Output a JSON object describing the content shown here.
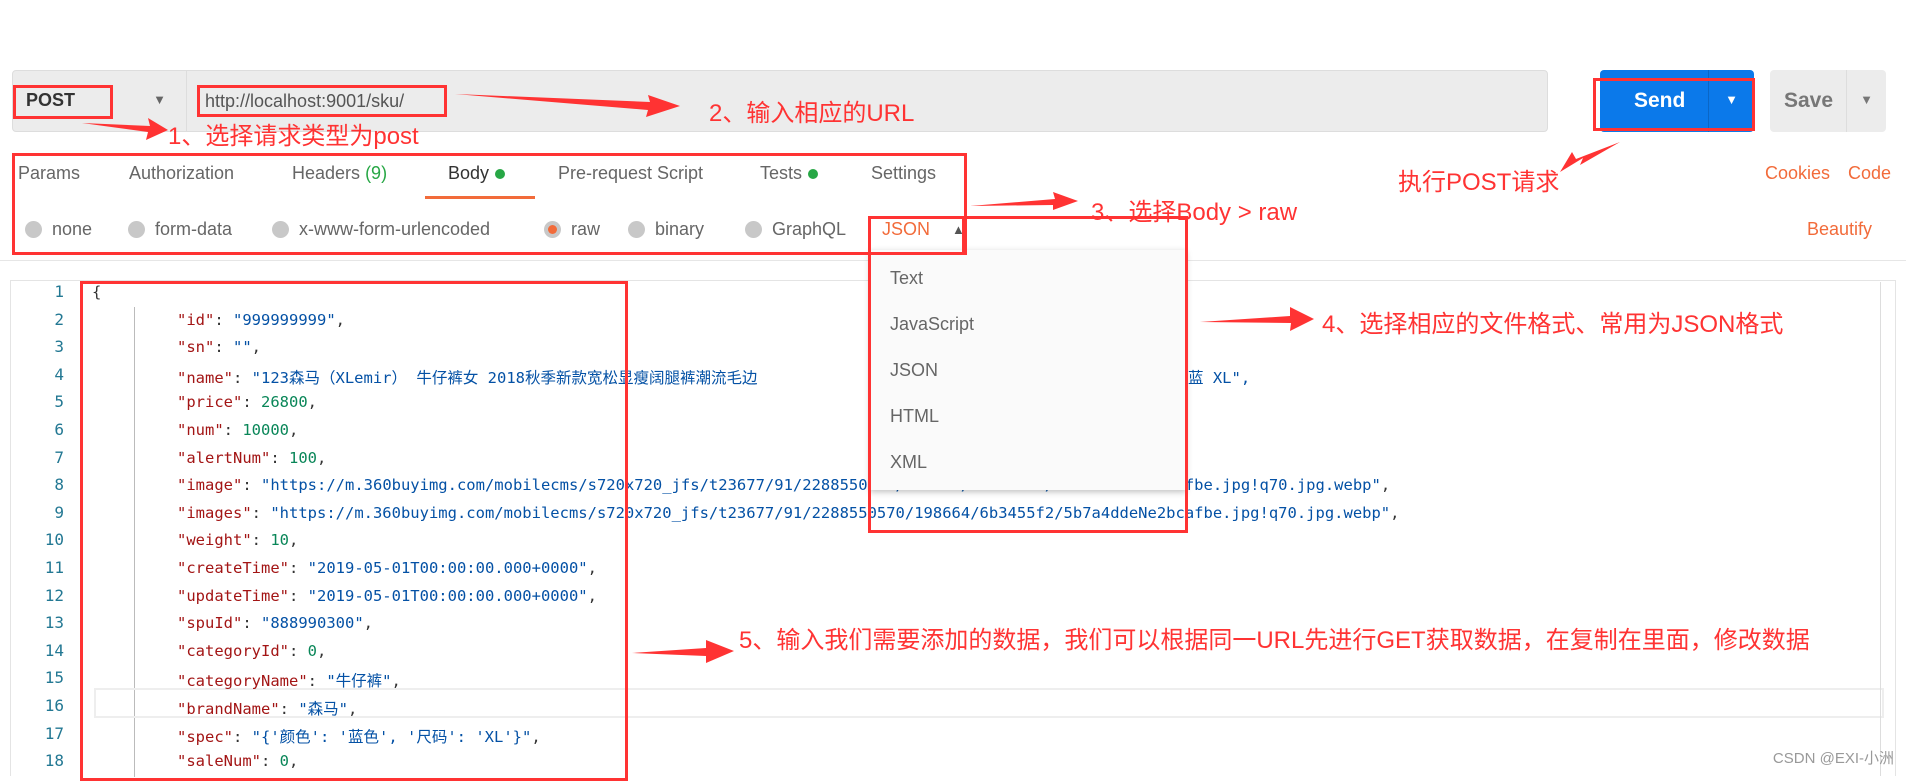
{
  "request": {
    "method": "POST",
    "url": "http://localhost:9001/sku/",
    "send_label": "Send",
    "save_label": "Save"
  },
  "tabs": [
    {
      "label": "Params"
    },
    {
      "label": "Authorization"
    },
    {
      "label": "Headers",
      "count": "(9)"
    },
    {
      "label": "Body",
      "active": true
    },
    {
      "label": "Pre-request Script"
    },
    {
      "label": "Tests"
    },
    {
      "label": "Settings"
    }
  ],
  "right_links": {
    "cookies": "Cookies",
    "code": "Code",
    "beautify": "Beautify"
  },
  "body_types": [
    {
      "label": "none"
    },
    {
      "label": "form-data"
    },
    {
      "label": "x-www-form-urlencoded"
    },
    {
      "label": "raw",
      "selected": true
    },
    {
      "label": "binary"
    },
    {
      "label": "GraphQL"
    }
  ],
  "format_select": {
    "value": "JSON",
    "options": [
      "Text",
      "JavaScript",
      "JSON",
      "HTML",
      "XML"
    ]
  },
  "editor": {
    "lines": [
      {
        "n": "1",
        "k": "{",
        "v": ""
      },
      {
        "n": "2",
        "k": "\"id\"",
        "v": "\"999999999\"",
        "t": "s"
      },
      {
        "n": "3",
        "k": "\"sn\"",
        "v": "\"\"",
        "t": "s"
      },
      {
        "n": "4",
        "k": "\"name\"",
        "v": "\"123森马（XLemir） 牛仔裤女 2018秋季新款宽松显瘦阔腿裤潮流毛边",
        "tail": "蓝 XL\",",
        "t": "s"
      },
      {
        "n": "5",
        "k": "\"price\"",
        "v": "26800",
        "t": "n"
      },
      {
        "n": "6",
        "k": "\"num\"",
        "v": "10000",
        "t": "n"
      },
      {
        "n": "7",
        "k": "\"alertNum\"",
        "v": "100",
        "t": "n"
      },
      {
        "n": "8",
        "k": "\"image\"",
        "v": "\"https://m.360buyimg.com/mobilecms/s720x720_jfs/t23677/91/2288550570/198664/6b3455f2/5b7a4ddeNe2bcafbe.jpg!q70.jpg.webp\"",
        "t": "s"
      },
      {
        "n": "9",
        "k": "\"images\"",
        "v": "\"https://m.360buyimg.com/mobilecms/s720x720_jfs/t23677/91/2288550570/198664/6b3455f2/5b7a4ddeNe2bcafbe.jpg!q70.jpg.webp\"",
        "t": "s"
      },
      {
        "n": "10",
        "k": "\"weight\"",
        "v": "10",
        "t": "n"
      },
      {
        "n": "11",
        "k": "\"createTime\"",
        "v": "\"2019-05-01T00:00:00.000+0000\"",
        "t": "s"
      },
      {
        "n": "12",
        "k": "\"updateTime\"",
        "v": "\"2019-05-01T00:00:00.000+0000\"",
        "t": "s"
      },
      {
        "n": "13",
        "k": "\"spuId\"",
        "v": "\"888990300\"",
        "t": "s"
      },
      {
        "n": "14",
        "k": "\"categoryId\"",
        "v": "0",
        "t": "n"
      },
      {
        "n": "15",
        "k": "\"categoryName\"",
        "v": "\"牛仔裤\"",
        "t": "s"
      },
      {
        "n": "16",
        "k": "\"brandName\"",
        "v": "\"森马\"",
        "t": "s"
      },
      {
        "n": "17",
        "k": "\"spec\"",
        "v": "\"{'颜色': '蓝色', '尺码': 'XL'}\"",
        "t": "s"
      },
      {
        "n": "18",
        "k": "\"saleNum\"",
        "v": "0",
        "t": "n"
      }
    ]
  },
  "annotations": {
    "a1": "1、选择请求类型为post",
    "a2": "2、输入相应的URL",
    "send": "执行POST请求",
    "a3": "3、选择Body > raw",
    "a4": "4、选择相应的文件格式、常用为JSON格式",
    "a5": "5、输入我们需要添加的数据，我们可以根据同一URL先进行GET获取数据，在复制在里面，修改数据"
  },
  "watermark": "CSDN @EXI-小洲",
  "colors": {
    "send": "#0b79ea",
    "accent": "#f26b3a",
    "annotation": "#ff3333",
    "success": "#27a745"
  }
}
